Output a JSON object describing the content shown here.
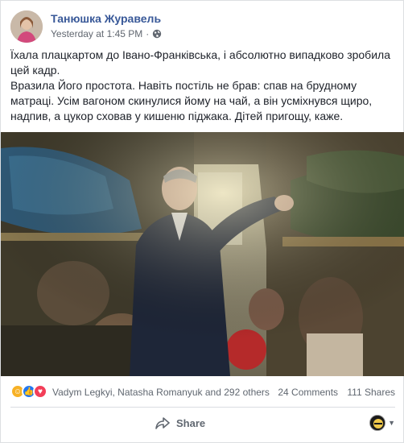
{
  "post": {
    "author": "Танюшка Журавель",
    "time": "Yesterday at 1:45 PM",
    "separator": "·",
    "privacy_icon": "globe-icon",
    "text_lines": [
      "Їхала плацкартом до Івано-Франківська, і абсолютно випадково зробила цей кадр.",
      "Вразила Його простота. Навіть постіль не брав: спав на брудному матраці. Усім вагоном скинулися йому на чай, а він усміхнувся щиро, надпив, а цукор сховав у кишеню піджака. Дітей пригощу, каже."
    ]
  },
  "reactions": {
    "icons": [
      "haha-icon",
      "like-icon",
      "love-icon"
    ],
    "names": "Vadym Legkyi, Natasha Romanyuk and 292 others",
    "comments": "24 Comments",
    "shares": "111 Shares"
  },
  "actions": {
    "share_label": "Share"
  },
  "colors": {
    "author_link": "#385898",
    "meta_text": "#616770",
    "like_blue": "#2078f4",
    "love_red": "#f33e58",
    "haha_yellow": "#f7b125"
  }
}
